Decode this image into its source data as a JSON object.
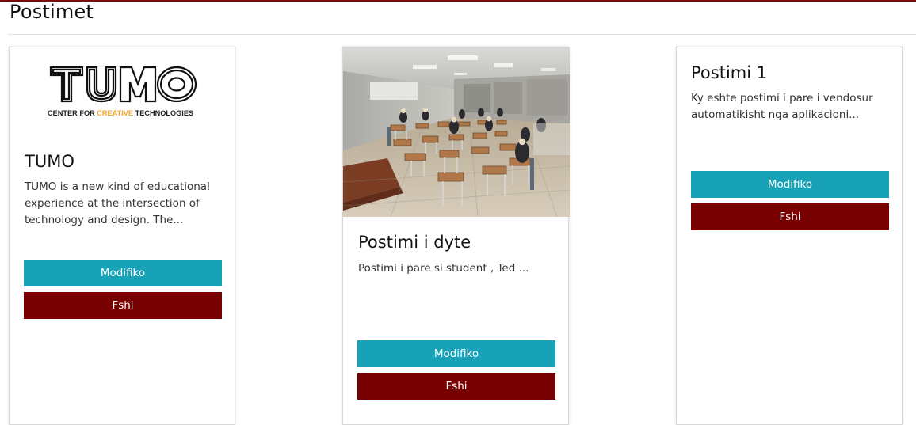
{
  "page": {
    "title": "Postimet"
  },
  "posts": [
    {
      "title": "TUMO",
      "excerpt": "TUMO is a new kind of educational experience at the intersection of technology and design. The...",
      "image": {
        "type": "logo",
        "wordmark": "TUMO",
        "tagline_prefix": "CENTER FOR ",
        "tagline_highlight": "CREATIVE",
        "tagline_suffix": " TECHNOLOGIES",
        "highlight_color": "#f5a623"
      },
      "edit_label": "Modifiko",
      "delete_label": "Fshi"
    },
    {
      "title": "Postimi i dyte",
      "excerpt": "Postimi i pare si student , Ted ...",
      "image": {
        "type": "photo",
        "subject": "classroom-exam-photo"
      },
      "edit_label": "Modifiko",
      "delete_label": "Fshi"
    },
    {
      "title": "Postimi 1",
      "excerpt": "Ky eshte postimi i pare i vendosur automatikisht nga aplikacioni...",
      "image": null,
      "edit_label": "Modifiko",
      "delete_label": "Fshi"
    }
  ],
  "colors": {
    "accent_rule": "#7a0b0b",
    "edit_button": "#17a2b8",
    "delete_button": "#780000"
  }
}
